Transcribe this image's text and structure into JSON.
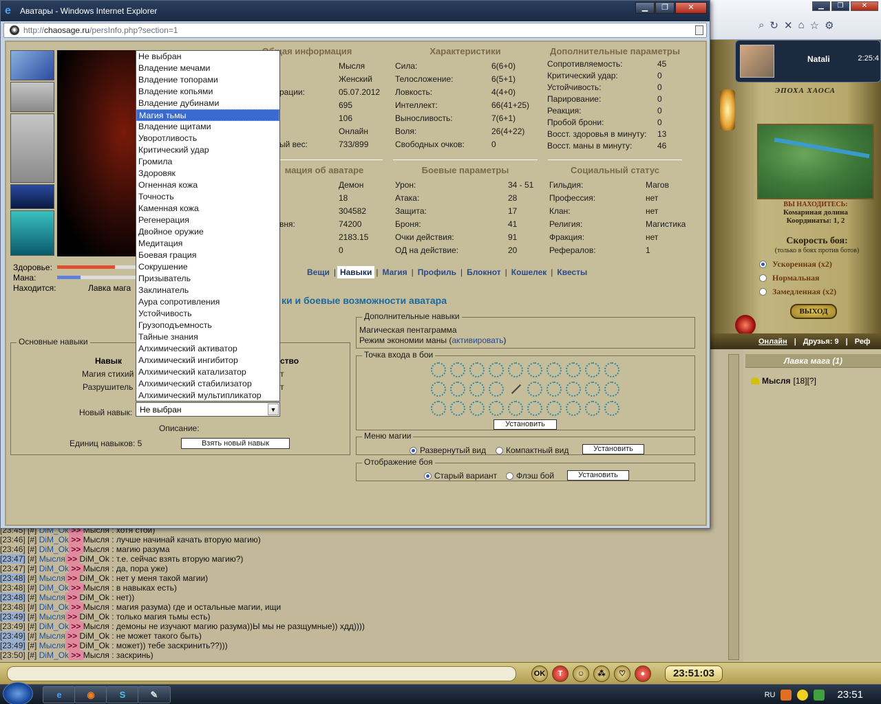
{
  "ie": {
    "title": "Аватары - Windows Internet Explorer",
    "url_host": "chaosage.ru",
    "url_prefix": "http://",
    "url_path": "/persInfo.php?section=1",
    "controls": {
      "min": "▁",
      "max": "❐",
      "close": "✕"
    }
  },
  "left": {
    "hp_label": "Здоровье:",
    "mp_label": "Мана:",
    "location_label": "Находится:",
    "location_value": "Лавка мага",
    "hp_fill": 0.7,
    "mp_fill": 0.28
  },
  "general_info": {
    "title": "Общая информация",
    "rows": [
      {
        "k": "",
        "v": "Мысля"
      },
      {
        "k": "",
        "v": "Женский"
      },
      {
        "k": "рации:",
        "v": "05.07.2012"
      },
      {
        "k": "",
        "v": "695"
      },
      {
        "k": "",
        "v": "106"
      },
      {
        "k": "",
        "v": "Онлайн"
      },
      {
        "k": "ый вес:",
        "v": "733/899"
      }
    ]
  },
  "characteristics": {
    "title": "Характеристики",
    "rows": [
      {
        "k": "Сила:",
        "v": "6(6+0)"
      },
      {
        "k": "Телосложение:",
        "v": "6(5+1)"
      },
      {
        "k": "Ловкость:",
        "v": "4(4+0)"
      },
      {
        "k": "Интеллект:",
        "v": "66(41+25)"
      },
      {
        "k": "Выносливость:",
        "v": "7(6+1)"
      },
      {
        "k": "Воля:",
        "v": "26(4+22)"
      },
      {
        "k": "Свободных очков:",
        "v": "0"
      }
    ]
  },
  "additional_params": {
    "title": "Дополнительные параметры",
    "rows": [
      {
        "k": "Сопротивляемость:",
        "v": "45"
      },
      {
        "k": "Критический удар:",
        "v": "0"
      },
      {
        "k": "Устойчивость:",
        "v": "0"
      },
      {
        "k": "Парирование:",
        "v": "0"
      },
      {
        "k": "Реакция:",
        "v": "0"
      },
      {
        "k": "Пробой брони:",
        "v": "0"
      },
      {
        "k": "Восст. здоровья в минуту:",
        "v": "13"
      },
      {
        "k": "Восст. маны в минуту:",
        "v": "46"
      }
    ]
  },
  "avatar_info": {
    "title": "мация об аватаре",
    "rows": [
      {
        "k": "",
        "v": "Демон"
      },
      {
        "k": "",
        "v": "18"
      },
      {
        "k": "",
        "v": "304582"
      },
      {
        "k": "вня:",
        "v": "74200"
      },
      {
        "k": "",
        "v": "2183.15"
      },
      {
        "k": "",
        "v": "0"
      }
    ]
  },
  "combat_params": {
    "title": "Боевые параметры",
    "rows": [
      {
        "k": "Урон:",
        "v": "34 - 51"
      },
      {
        "k": "Атака:",
        "v": "28"
      },
      {
        "k": "Защита:",
        "v": "17"
      },
      {
        "k": "Броня:",
        "v": "41"
      },
      {
        "k": "Очки действия:",
        "v": "91"
      },
      {
        "k": "ОД на действие:",
        "v": "20"
      }
    ]
  },
  "social": {
    "title": "Социальный статус",
    "rows": [
      {
        "k": "Гильдия:",
        "v": "Магов"
      },
      {
        "k": "Профессия:",
        "v": "нет"
      },
      {
        "k": "Клан:",
        "v": "нет"
      },
      {
        "k": "Религия:",
        "v": "Магистика"
      },
      {
        "k": "Фракция:",
        "v": "нет"
      },
      {
        "k": "Рефералов:",
        "v": "1"
      }
    ]
  },
  "nav": {
    "items": [
      "Вещи",
      "Навыки",
      "Магия",
      "Профиль",
      "Блокнот",
      "Кошелек",
      "Квесты"
    ],
    "active": 1
  },
  "section_heading": "ки и боевые возможности аватара",
  "basic_skills": {
    "legend": "Основные навыки",
    "col1": "Навык",
    "col2": "ство",
    "rows": [
      {
        "k": "Магия стихий",
        "v": "т"
      },
      {
        "k": "Разрушитель",
        "v": "т"
      }
    ],
    "new_skill_label": "Новый навык:",
    "description_label": "Описание:",
    "units_label": "Единиц навыков: 5",
    "take_btn": "Взять новый навык"
  },
  "dropdown": {
    "selected": "Не выбран",
    "highlighted": 5,
    "options": [
      "Не выбран",
      "Владение мечами",
      "Владение топорами",
      "Владение копьями",
      "Владение дубинами",
      "Магия тьмы",
      "Владение щитами",
      "Уворотливость",
      "Критический удар",
      "Громила",
      "Здоровяк",
      "Огненная кожа",
      "Точность",
      "Каменная кожа",
      "Регенерация",
      "Двойное оружие",
      "Медитация",
      "Боевая грация",
      "Сокрушение",
      "Призыватель",
      "Заклинатель",
      "Аура сопротивления",
      "Устойчивость",
      "Грузоподъемность",
      "Тайные знания",
      "Алхимический активатор",
      "Алхимический ингибитор",
      "Алхимический катализатор",
      "Алхимический стабилизатор",
      "Алхимический мультипликатор"
    ]
  },
  "extra_skills": {
    "legend": "Дополнительные навыки",
    "line1": "Магическая пентаграмма",
    "line2_prefix": "Режим экономии маны (",
    "line2_link": "активировать",
    "line2_suffix": ")"
  },
  "entry_point": {
    "legend": "Точка входа в бои",
    "btn": "Установить"
  },
  "magic_menu": {
    "legend": "Меню магии",
    "opt1": "Развернутый вид",
    "opt2": "Компактный вид",
    "btn": "Установить"
  },
  "battle_display": {
    "legend": "Отображение боя",
    "opt1": "Старый вариант",
    "opt2": "Флэш бой",
    "btn": "Установить"
  },
  "right_panel": {
    "user_name": "Natali",
    "time": "2:25:4",
    "logo": "ЭПОХА ХАОСА",
    "loc_label": "ВЫ НАХОДИТЕСЬ:",
    "loc_name": "Комариная долина",
    "coords": "Координаты: 1, 2",
    "speed_title": "Скорость боя:",
    "speed_sub": "(только в боях против ботов)",
    "speed_opts": [
      "Ускоренная (x2)",
      "Нормальная",
      "Замедленная (x2)"
    ],
    "exit_btn": "ВЫХОД",
    "online": "Онлайн",
    "friends": "Друзья: 9",
    "ref": "Реф"
  },
  "users": {
    "title": "Лавка мага (1)",
    "name": "Мысля",
    "suffix": "[18][?]"
  },
  "chat": [
    {
      "t": "[23:45]",
      "hl": false,
      "from": "DiM_Ok",
      "to": "Мысля",
      "msg": "хотя стой)"
    },
    {
      "t": "[23:46]",
      "hl": false,
      "from": "DiM_Ok",
      "to": "Мысля",
      "msg": "лучше начинай качать вторую магию)"
    },
    {
      "t": "[23:46]",
      "hl": false,
      "from": "DiM_Ok",
      "to": "Мысля",
      "msg": "магию разума"
    },
    {
      "t": "[23:47]",
      "hl": true,
      "from": "Мысля",
      "to": "DiM_Ok",
      "msg": "т.е. сейчас взять вторую магию?)"
    },
    {
      "t": "[23:47]",
      "hl": false,
      "from": "DiM_Ok",
      "to": "Мысля",
      "msg": "да, пора уже)"
    },
    {
      "t": "[23:48]",
      "hl": true,
      "from": "Мысля",
      "to": "DiM_Ok",
      "msg": "нет у меня такой магии)"
    },
    {
      "t": "[23:48]",
      "hl": false,
      "from": "DiM_Ok",
      "to": "Мысля",
      "msg": "в навыках есть)"
    },
    {
      "t": "[23:48]",
      "hl": true,
      "from": "Мысля",
      "to": "DiM_Ok",
      "msg": "нет))"
    },
    {
      "t": "[23:48]",
      "hl": false,
      "from": "DiM_Ok",
      "to": "Мысля",
      "msg": "магия разума) где и остальные магии, ищи"
    },
    {
      "t": "[23:49]",
      "hl": true,
      "from": "Мысля",
      "to": "DiM_Ok",
      "msg": "только магия тьмы есть)"
    },
    {
      "t": "[23:49]",
      "hl": false,
      "from": "DiM_Ok",
      "to": "Мысля",
      "msg": "демоны не изучают магию разума))Ы мы не разщумные)) хдд))))"
    },
    {
      "t": "[23:49]",
      "hl": true,
      "from": "Мысля",
      "to": "DiM_Ok",
      "msg": "не может такого быть)"
    },
    {
      "t": "[23:49]",
      "hl": true,
      "from": "Мысля",
      "to": "DiM_Ok",
      "msg": "может)) тебе заскринить??)))"
    },
    {
      "t": "[23:50]",
      "hl": false,
      "from": "DiM_Ok",
      "to": "Мысля",
      "msg": "заскринь)"
    }
  ],
  "chat_bar": {
    "ok": "OK",
    "t": "T",
    "clock": "23:51:03"
  },
  "taskbar": {
    "lang": "RU",
    "clock": "23:51"
  }
}
